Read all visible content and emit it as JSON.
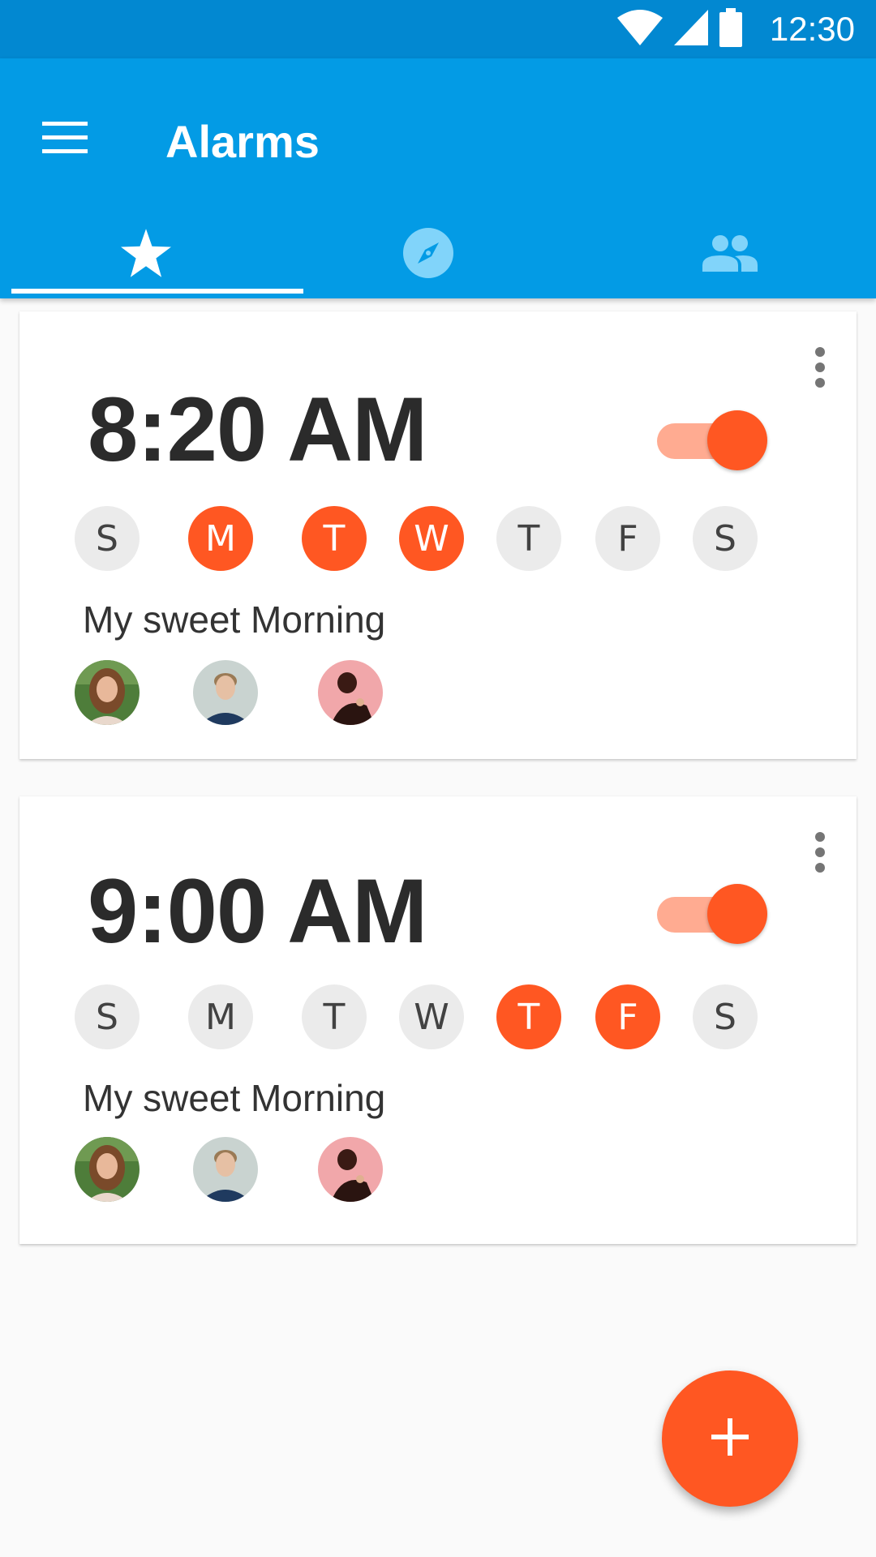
{
  "status_bar": {
    "time": "12:30",
    "icons": [
      "wifi-icon",
      "cell-signal-icon",
      "battery-icon"
    ]
  },
  "app_bar": {
    "title": "Alarms",
    "menu_icon": "menu-icon",
    "tabs": [
      {
        "icon": "star-icon",
        "selected": true
      },
      {
        "icon": "compass-icon",
        "selected": false
      },
      {
        "icon": "people-icon",
        "selected": false
      }
    ]
  },
  "alarms": [
    {
      "time": "8:20 AM",
      "enabled": true,
      "label": "My sweet Morning",
      "days": [
        {
          "letter": "S",
          "active": false
        },
        {
          "letter": "M",
          "active": true
        },
        {
          "letter": "T",
          "active": true
        },
        {
          "letter": "W",
          "active": true
        },
        {
          "letter": "T",
          "active": false
        },
        {
          "letter": "F",
          "active": false
        },
        {
          "letter": "S",
          "active": false
        }
      ],
      "avatars": 3
    },
    {
      "time": "9:00 AM",
      "enabled": true,
      "label": "My sweet Morning",
      "days": [
        {
          "letter": "S",
          "active": false
        },
        {
          "letter": "M",
          "active": false
        },
        {
          "letter": "T",
          "active": false
        },
        {
          "letter": "W",
          "active": false
        },
        {
          "letter": "T",
          "active": true
        },
        {
          "letter": "F",
          "active": true
        },
        {
          "letter": "S",
          "active": false
        }
      ],
      "avatars": 3
    }
  ],
  "fab": {
    "icon": "plus-icon"
  },
  "colors": {
    "status_bar": "#0288d1",
    "app_bar": "#039be5",
    "accent": "#ff5722",
    "accent_light": "#ffab91",
    "inactive_tab_icon": "#81d4fa"
  }
}
